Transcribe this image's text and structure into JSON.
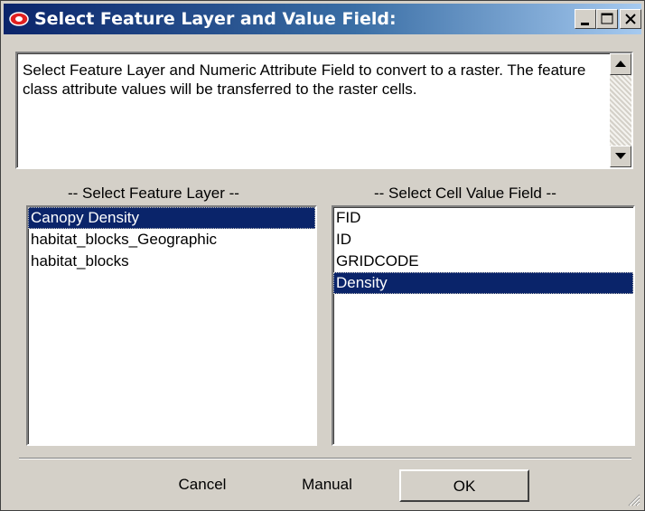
{
  "window": {
    "title": "Select Feature Layer and Value Field:",
    "icon": "arcgis-tool-icon",
    "controls": [
      "minimize-icon",
      "maximize-icon",
      "close-icon"
    ]
  },
  "description": "Select Feature Layer and Numeric Attribute Field to convert to a raster.  The feature class attribute values will be transferred to the raster cells.",
  "layers": {
    "label": "-- Select Feature Layer --",
    "items": [
      "Canopy Density",
      "habitat_blocks_Geographic",
      "habitat_blocks"
    ],
    "selected": "Canopy Density"
  },
  "fields": {
    "label": "-- Select Cell Value Field --",
    "items": [
      "FID",
      "ID",
      "GRIDCODE",
      "Density"
    ],
    "selected": "Density"
  },
  "buttons": {
    "cancel": "Cancel",
    "manual": "Manual",
    "ok": "OK"
  },
  "colors": {
    "titlebar_start": "#0a246a",
    "titlebar_end": "#a6caf0",
    "selection": "#0a246a",
    "face": "#d4d0c8"
  }
}
